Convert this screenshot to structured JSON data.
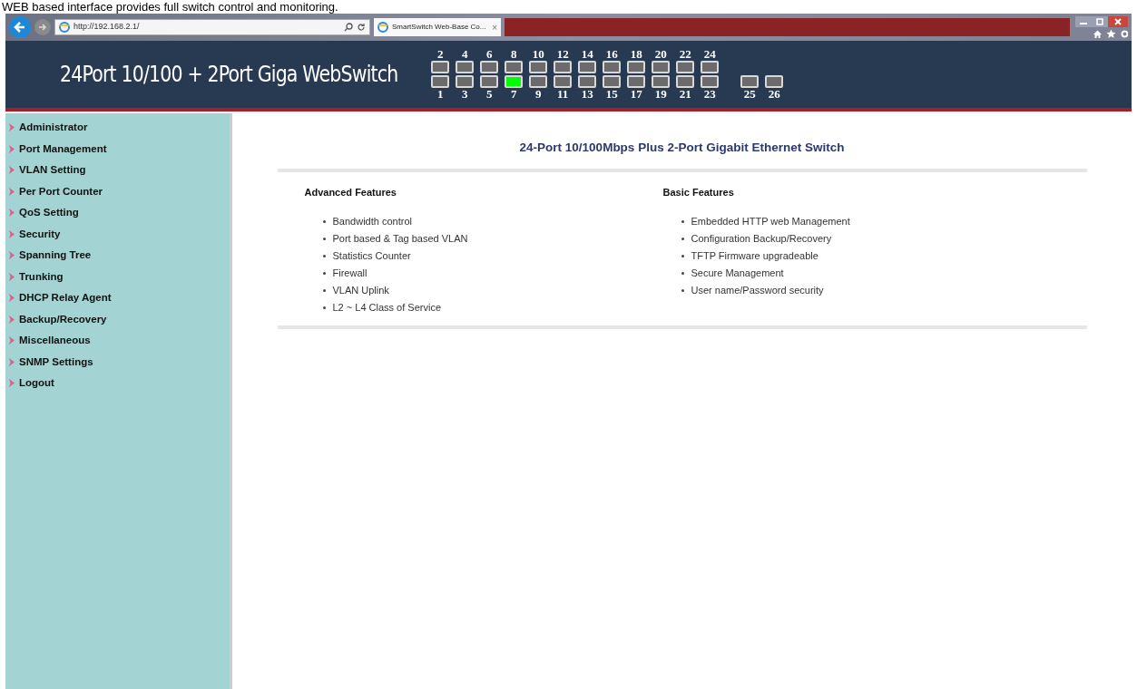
{
  "caption": "WEB based interface provides full switch control and monitoring.",
  "browser": {
    "address": "http://192.168.2.1/",
    "tab": {
      "label": "SmartSwitch Web-Base Co...",
      "close": "×",
      "selected": true
    }
  },
  "header": {
    "title": "24Port 10/100 + 2Port Giga WebSwitch",
    "top_ports": [
      {
        "label": "2",
        "link": false
      },
      {
        "label": "4",
        "link": false
      },
      {
        "label": "6",
        "link": false
      },
      {
        "label": "8",
        "link": false
      },
      {
        "label": "10",
        "link": false
      },
      {
        "label": "12",
        "link": false
      },
      {
        "label": "14",
        "link": false
      },
      {
        "label": "16",
        "link": false
      },
      {
        "label": "18",
        "link": false
      },
      {
        "label": "20",
        "link": false
      },
      {
        "label": "22",
        "link": false
      },
      {
        "label": "24",
        "link": false
      }
    ],
    "bottom_ports": [
      {
        "label": "1",
        "link": false
      },
      {
        "label": "3",
        "link": false
      },
      {
        "label": "5",
        "link": false
      },
      {
        "label": "7",
        "link": true
      },
      {
        "label": "9",
        "link": false
      },
      {
        "label": "11",
        "link": false
      },
      {
        "label": "13",
        "link": false
      },
      {
        "label": "15",
        "link": false
      },
      {
        "label": "17",
        "link": false
      },
      {
        "label": "19",
        "link": false
      },
      {
        "label": "21",
        "link": false
      },
      {
        "label": "23",
        "link": false
      }
    ],
    "giga_ports": [
      {
        "label": "25",
        "link": false
      },
      {
        "label": "26",
        "link": false
      }
    ]
  },
  "sidebar": {
    "items": [
      "Administrator",
      "Port Management",
      "VLAN Setting",
      "Per Port Counter",
      "QoS Setting",
      "Security",
      "Spanning Tree",
      "Trunking",
      "DHCP Relay Agent",
      "Backup/Recovery",
      "Miscellaneous",
      "SNMP Settings",
      "Logout"
    ]
  },
  "main": {
    "title": "24-Port 10/100Mbps Plus 2-Port Gigabit Ethernet Switch",
    "columns": [
      {
        "heading": "Advanced Features",
        "items": [
          "Bandwidth control",
          "Port based & Tag based VLAN",
          "Statistics Counter",
          "Firewall",
          "VLAN Uplink",
          "L2 ~ L4 Class of Service"
        ]
      },
      {
        "heading": "Basic Features",
        "items": [
          "Embedded HTTP web Management",
          "Configuration Backup/Recovery",
          "TFTP Firmware upgradeable",
          "Secure Management",
          "User name/Password security"
        ]
      }
    ]
  }
}
